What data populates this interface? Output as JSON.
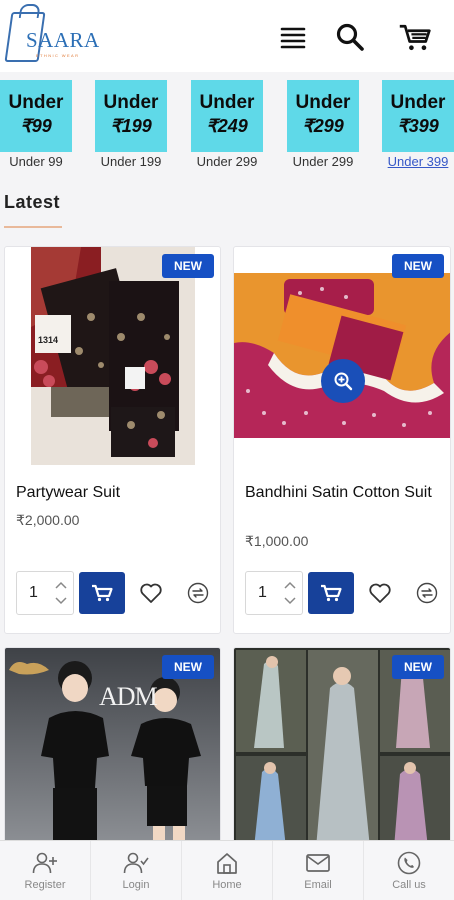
{
  "header": {
    "logo_text": "SAARA",
    "logo_subtext": "ETHNIC WEAR",
    "icons": [
      "menu-icon",
      "search-icon",
      "cart-icon"
    ]
  },
  "price_chips": [
    {
      "line1": "Under",
      "line2": "₹99",
      "caption": "Under 99"
    },
    {
      "line1": "Under",
      "line2": "₹199",
      "caption": "Under 199"
    },
    {
      "line1": "Under",
      "line2": "₹249",
      "caption": "Under 299"
    },
    {
      "line1": "Under",
      "line2": "₹299",
      "caption": "Under 299"
    },
    {
      "line1": "Under",
      "line2": "₹399",
      "caption": "Under 399"
    }
  ],
  "latest": {
    "title": "Latest"
  },
  "products": [
    {
      "badge": "NEW",
      "name": "Partywear Suit",
      "price": "₹2,000.00",
      "qty": "1",
      "image_number": "1314"
    },
    {
      "badge": "NEW",
      "name": "Bandhini Satin Cotton Suit",
      "price": "₹1,000.00",
      "qty": "1"
    },
    {
      "badge": "NEW",
      "brand_text": "ADM"
    },
    {
      "badge": "NEW"
    }
  ],
  "bottom_nav": [
    {
      "label": "Register",
      "icon": "user-plus-icon"
    },
    {
      "label": "Login",
      "icon": "user-check-icon"
    },
    {
      "label": "Home",
      "icon": "home-icon"
    },
    {
      "label": "Email",
      "icon": "mail-icon"
    },
    {
      "label": "Call us",
      "icon": "phone-icon"
    }
  ],
  "colors": {
    "chip_bg": "#5fd9e8",
    "accent_blue": "#1650c4",
    "cart_button": "#17419a",
    "link": "#3658c8"
  }
}
